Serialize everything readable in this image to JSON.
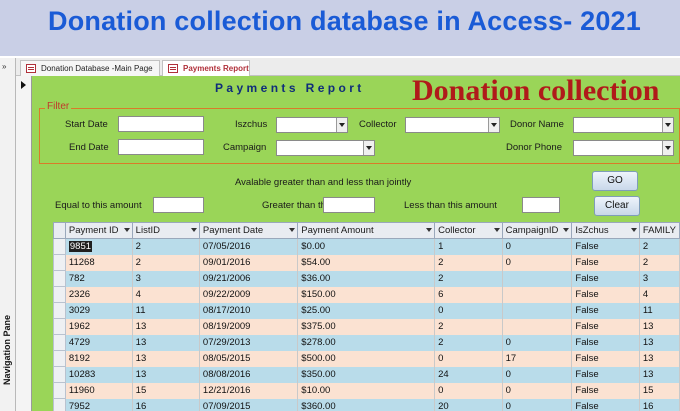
{
  "banner": {
    "title": "Donation collection database in Access- 2021"
  },
  "nav": {
    "label": "Navigation Pane",
    "chevron": "»"
  },
  "tabs": [
    {
      "label": "Donation Database -Main Page"
    },
    {
      "label": "Payments Report"
    }
  ],
  "form": {
    "report_title": "Payments Report",
    "big_title": "Donation collection",
    "filter": {
      "legend": "Filter",
      "start_date_label": "Start Date",
      "end_date_label": "End Date",
      "iszchus_label": "Iszchus",
      "campaign_label": "Campaign",
      "collector_label": "Collector",
      "donor_name_label": "Donor Name",
      "donor_phone_label": "Donor  Phone"
    },
    "available_label": "Avalable greater than and less than jointly",
    "equal_label": "Equal to this amount",
    "greater_label": "Greater than this->",
    "less_label": "Less than this amount",
    "go_button": "GO",
    "clear_button": "Clear"
  },
  "table": {
    "columns": [
      "Payment ID",
      "ListID",
      "Payment Date",
      "Payment Amount",
      "Collector",
      "CampaignID",
      "IsZchus",
      "FAMILY"
    ],
    "rows": [
      [
        "9851",
        "2",
        "07/05/2016",
        "$0.00",
        "1",
        "0",
        "False",
        "2"
      ],
      [
        "11268",
        "2",
        "09/01/2016",
        "$54.00",
        "2",
        "0",
        "False",
        "2"
      ],
      [
        "782",
        "3",
        "09/21/2006",
        "$36.00",
        "2",
        "",
        "False",
        "3"
      ],
      [
        "2326",
        "4",
        "09/22/2009",
        "$150.00",
        "6",
        "",
        "False",
        "4"
      ],
      [
        "3029",
        "11",
        "08/17/2010",
        "$25.00",
        "0",
        "",
        "False",
        "11"
      ],
      [
        "1962",
        "13",
        "08/19/2009",
        "$375.00",
        "2",
        "",
        "False",
        "13"
      ],
      [
        "4729",
        "13",
        "07/29/2013",
        "$278.00",
        "2",
        "0",
        "False",
        "13"
      ],
      [
        "8192",
        "13",
        "08/05/2015",
        "$500.00",
        "0",
        "17",
        "False",
        "13"
      ],
      [
        "10283",
        "13",
        "08/08/2016",
        "$350.00",
        "24",
        "0",
        "False",
        "13"
      ],
      [
        "11960",
        "15",
        "12/21/2016",
        "$10.00",
        "0",
        "0",
        "False",
        "15"
      ],
      [
        "7952",
        "16",
        "07/09/2015",
        "$360.00",
        "20",
        "0",
        "False",
        "16"
      ]
    ]
  }
}
